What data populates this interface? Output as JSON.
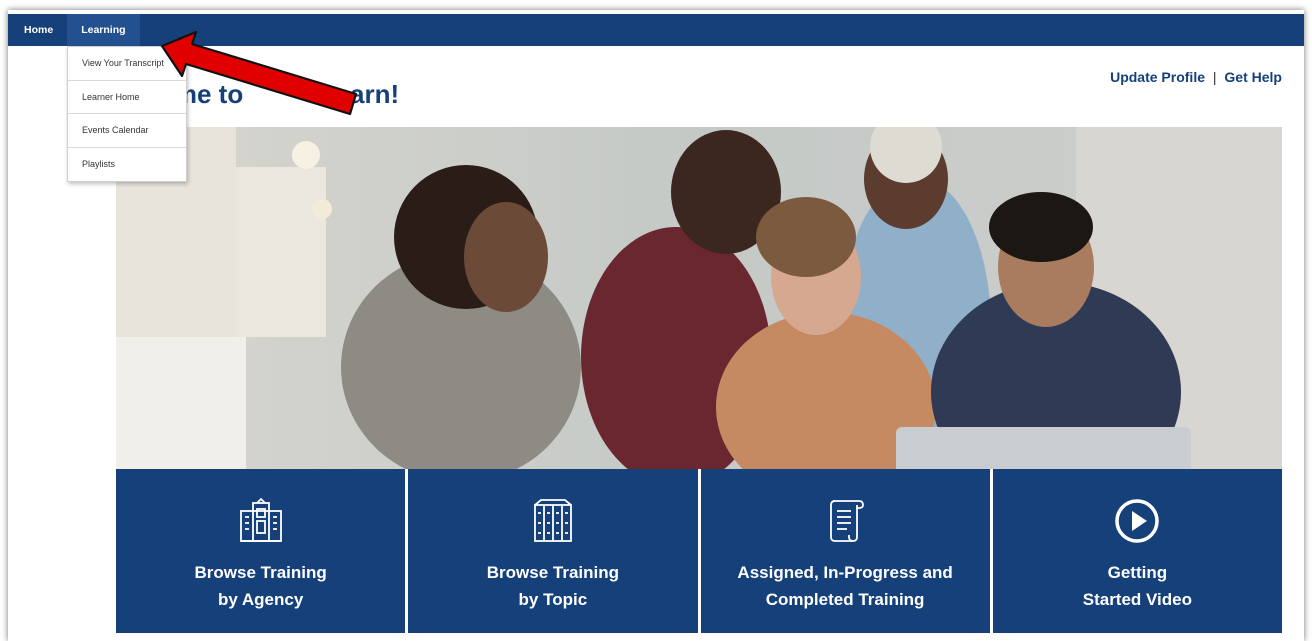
{
  "nav": {
    "home": "Home",
    "learning": "Learning"
  },
  "dropdown": {
    "items": [
      "View Your Transcript",
      "Learner Home",
      "Events Calendar",
      "Playlists"
    ]
  },
  "welcome": {
    "title_visible": "ome to",
    "title_visible_2": "Learn!"
  },
  "links": {
    "update_profile": "Update Profile",
    "separator": "|",
    "get_help": "Get Help"
  },
  "tiles": [
    {
      "line1": "Browse Training",
      "line2": "by Agency",
      "icon": "building-icon"
    },
    {
      "line1": "Browse Training",
      "line2": "by Topic",
      "icon": "bookshelf-icon"
    },
    {
      "line1": "Assigned, In-Progress and",
      "line2": "Completed Training",
      "icon": "scroll-icon"
    },
    {
      "line1": "Getting",
      "line2": "Started Video",
      "icon": "play-icon"
    }
  ],
  "colors": {
    "brand": "#15407a",
    "arrow": "#e00000"
  }
}
